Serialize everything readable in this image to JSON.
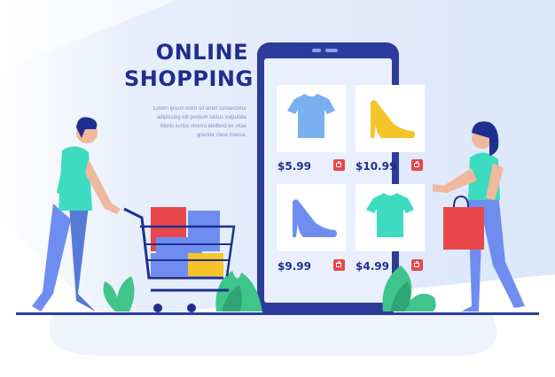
{
  "headline": {
    "line1": "ONLINE",
    "line2": "SHOPPING"
  },
  "body_text": [
    "Lorem ipsum dolor sit amet consectetur",
    "adipiscing elit pretium luctus vulputate",
    "Morbi luctus viverra eleifend ex vitae",
    "gravida class massa."
  ],
  "products": [
    {
      "icon": "tshirt-icon",
      "color": "#7aaff0",
      "price": "$5.99"
    },
    {
      "icon": "high-heel-shoe-icon",
      "color": "#f5c428",
      "price": "$10.99"
    },
    {
      "icon": "high-heel-shoe-icon",
      "color": "#6f8df0",
      "price": "$9.99"
    },
    {
      "icon": "tshirt-icon",
      "color": "#3ddbc0",
      "price": "$4.99"
    }
  ],
  "colors": {
    "navy": "#1f2f8f",
    "phone_frame": "#2b3c9c",
    "badge_red": "#e8474b",
    "teal": "#3ddbc0",
    "leaf_green": "#3fc58a"
  }
}
